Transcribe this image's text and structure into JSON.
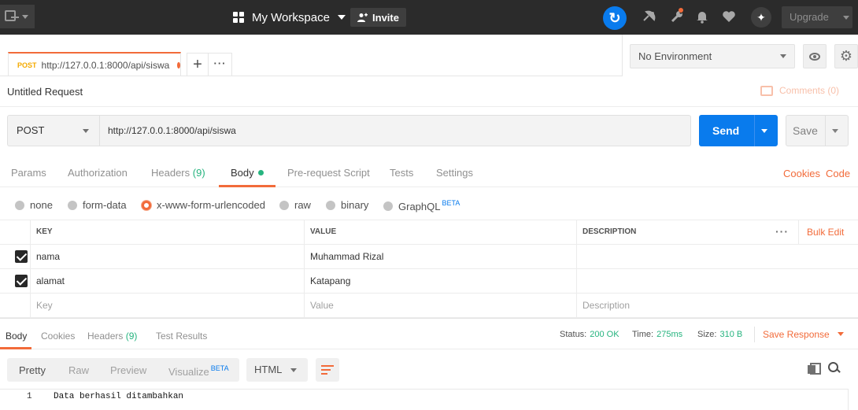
{
  "topbar": {
    "workspace": "My Workspace",
    "invite": "Invite",
    "upgrade": "Upgrade"
  },
  "tabs": {
    "active": {
      "method": "POST",
      "url": "http://127.0.0.1:8000/api/siswa"
    }
  },
  "environment": {
    "selected": "No Environment"
  },
  "request": {
    "title": "Untitled Request",
    "comments": "Comments (0)",
    "method": "POST",
    "url": "http://127.0.0.1:8000/api/siswa",
    "send": "Send",
    "save": "Save"
  },
  "request_tabs": {
    "params": "Params",
    "authorization": "Authorization",
    "headers": "Headers",
    "headers_count": "(9)",
    "body": "Body",
    "prerequest": "Pre-request Script",
    "tests": "Tests",
    "settings": "Settings",
    "cookies": "Cookies",
    "code": "Code"
  },
  "body_types": {
    "none": "none",
    "form_data": "form-data",
    "urlencoded": "x-www-form-urlencoded",
    "raw": "raw",
    "binary": "binary",
    "graphql": "GraphQL",
    "beta": "BETA",
    "selected": "x-www-form-urlencoded"
  },
  "kv_table": {
    "headers": {
      "key": "KEY",
      "value": "VALUE",
      "description": "DESCRIPTION"
    },
    "bulk_edit": "Bulk Edit",
    "rows": [
      {
        "key": "nama",
        "value": "Muhammad Rizal",
        "description": ""
      },
      {
        "key": "alamat",
        "value": "Katapang",
        "description": ""
      }
    ],
    "placeholder": {
      "key": "Key",
      "value": "Value",
      "description": "Description"
    }
  },
  "response": {
    "tabs": {
      "body": "Body",
      "cookies": "Cookies",
      "headers": "Headers",
      "headers_count": "(9)",
      "test_results": "Test Results"
    },
    "status_label": "Status:",
    "status": "200 OK",
    "time_label": "Time:",
    "time": "275ms",
    "size_label": "Size:",
    "size": "310 B",
    "save_response": "Save Response",
    "view": {
      "pretty": "Pretty",
      "raw": "Raw",
      "preview": "Preview",
      "visualize": "Visualize",
      "beta": "BETA"
    },
    "format": "HTML",
    "lines": [
      {
        "number": "1",
        "text": "Data berhasil ditambahkan"
      }
    ]
  },
  "colors": {
    "accent": "#f26b3a",
    "primary": "#097bed",
    "success": "#26b47f",
    "topbar": "#2b2b2b"
  }
}
